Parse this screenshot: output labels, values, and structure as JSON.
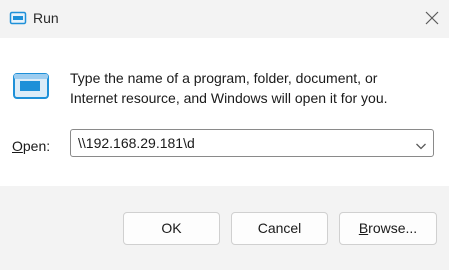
{
  "window": {
    "title": "Run",
    "icon": "run-icon"
  },
  "titlebar": {
    "close_icon": "close-icon"
  },
  "description": {
    "line1": "Type the name of a program, folder, document, or",
    "line2": "Internet resource, and Windows will open it for you."
  },
  "open": {
    "label_mnemonic": "O",
    "label_rest": "pen:",
    "value": "\\\\192.168.29.181\\d",
    "dropdown_icon": "chevron-down-icon"
  },
  "buttons": {
    "ok": "OK",
    "cancel": "Cancel",
    "browse_mnemonic": "B",
    "browse_rest": "rowse..."
  },
  "colors": {
    "icon_accent": "#1e90d8",
    "content_bg": "#ffffff",
    "chrome_bg": "#f3f3f3"
  }
}
